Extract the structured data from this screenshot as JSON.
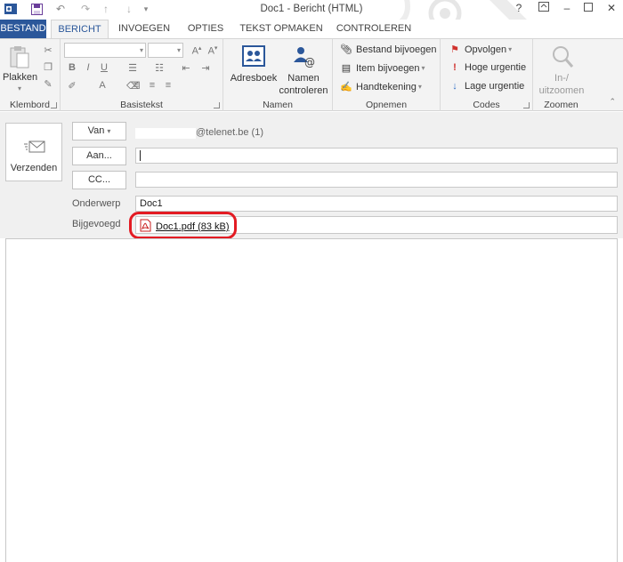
{
  "window": {
    "title": "Doc1 - Bericht (HTML)",
    "controls": {
      "help": "?",
      "minimize": "–",
      "close": "✕"
    }
  },
  "tabs": [
    "BESTAND",
    "BERICHT",
    "INVOEGEN",
    "OPTIES",
    "TEKST OPMAKEN",
    "CONTROLEREN"
  ],
  "ribbon": {
    "klembord": {
      "label": "Klembord",
      "paste": "Plakken"
    },
    "basistekst": {
      "label": "Basistekst"
    },
    "namen": {
      "label": "Namen",
      "address_book": "Adresboek",
      "check_names_1": "Namen",
      "check_names_2": "controleren"
    },
    "opnemen": {
      "label": "Opnemen",
      "attach_file": "Bestand bijvoegen",
      "attach_item": "Item bijvoegen",
      "signature": "Handtekening"
    },
    "codes": {
      "label": "Codes",
      "follow_up": "Opvolgen",
      "high": "Hoge urgentie",
      "low": "Lage urgentie"
    },
    "zoomen": {
      "label": "Zoomen",
      "zoom_1": "In-/",
      "zoom_2": "uitzoomen"
    }
  },
  "header": {
    "send": "Verzenden",
    "from_button": "Van",
    "from_value": "@telenet.be (1)",
    "to_button": "Aan...",
    "to_value": "",
    "cc_button": "CC...",
    "cc_value": "",
    "subject_label": "Onderwerp",
    "subject_value": "Doc1",
    "attached_label": "Bijgevoegd",
    "attachment": "Doc1.pdf (83 kB)"
  },
  "colors": {
    "file_tab": "#2b579a",
    "active_tab_text": "#2b579a",
    "highlight": "#e31b23",
    "high_importance": "#d0312d",
    "low_importance": "#2e6ec7",
    "pdf_icon": "#c81f1f"
  },
  "icons": [
    "save-icon",
    "undo-icon",
    "redo-icon",
    "up-icon",
    "down-icon",
    "paste-icon",
    "cut-icon",
    "copy-icon",
    "format-painter-icon",
    "address-book-icon",
    "check-names-icon",
    "paperclip-icon",
    "attach-item-icon",
    "signature-icon",
    "flag-icon",
    "exclamation-icon",
    "down-arrow-icon",
    "zoom-icon",
    "send-envelope-icon",
    "pdf-icon"
  ]
}
